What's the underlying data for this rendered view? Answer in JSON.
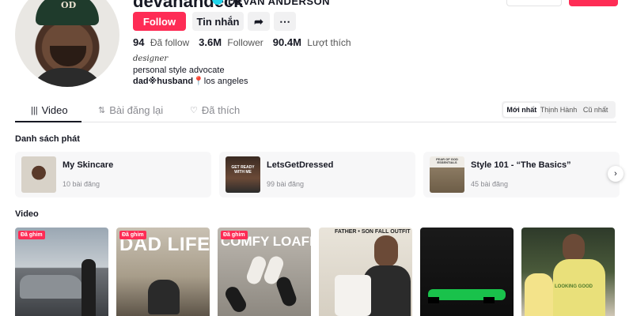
{
  "profile": {
    "username": "devanandeck",
    "display_name": "DEVAN ANDERSON",
    "follow_label": "Follow",
    "message_label": "Tin nhắn",
    "share_icon": "share-icon",
    "more_icon": "more-icon",
    "stats": [
      {
        "value": "94",
        "label": "Đã follow"
      },
      {
        "value": "3.6M",
        "label": "Follower"
      },
      {
        "value": "90.4M",
        "label": "Lượt thích"
      }
    ],
    "bio": {
      "role": "designer",
      "description": "personal style advocate",
      "tags_bold": "dad※husband",
      "tags_rest": "los angeles"
    }
  },
  "tabs": [
    {
      "label": "Video",
      "icon": "grid-icon",
      "active": true
    },
    {
      "label": "Bài đăng lại",
      "icon": "repost-icon",
      "active": false
    },
    {
      "label": "Đã thích",
      "icon": "heart-icon",
      "active": false
    }
  ],
  "sort": {
    "options": [
      "Mới nhất",
      "Thịnh Hành",
      "Cũ nhất"
    ],
    "selected": "Mới nhất"
  },
  "playlists": {
    "title": "Danh sách phát",
    "items": [
      {
        "name": "My Skincare",
        "count": "10 bài đăng"
      },
      {
        "name": "LetsGetDressed",
        "count": "99 bài đăng",
        "thumb_text": "GET READY WITH ME"
      },
      {
        "name": "Style 101 - “The Basics”",
        "count": "45 bài đăng",
        "thumb_text": "FEAR OF GOD ESSENTIALS"
      }
    ],
    "next_icon": "chevron-right-icon"
  },
  "videos": {
    "title": "Video",
    "pinned_label": "Đã ghim",
    "items": [
      {
        "pinned": true,
        "overlay": ""
      },
      {
        "pinned": true,
        "overlay": "DAD LIFE"
      },
      {
        "pinned": true,
        "overlay": "COMFY LOAFERS"
      },
      {
        "pinned": false,
        "overlay": "FATHER • SON FALL OUTFIT"
      },
      {
        "pinned": false,
        "overlay": ""
      },
      {
        "pinned": false,
        "overlay": "LOOKING GOOD"
      }
    ]
  },
  "colors": {
    "accent": "#fe2c55",
    "verified": "#20d5ec",
    "text": "#161823",
    "muted": "#8a8b91"
  }
}
